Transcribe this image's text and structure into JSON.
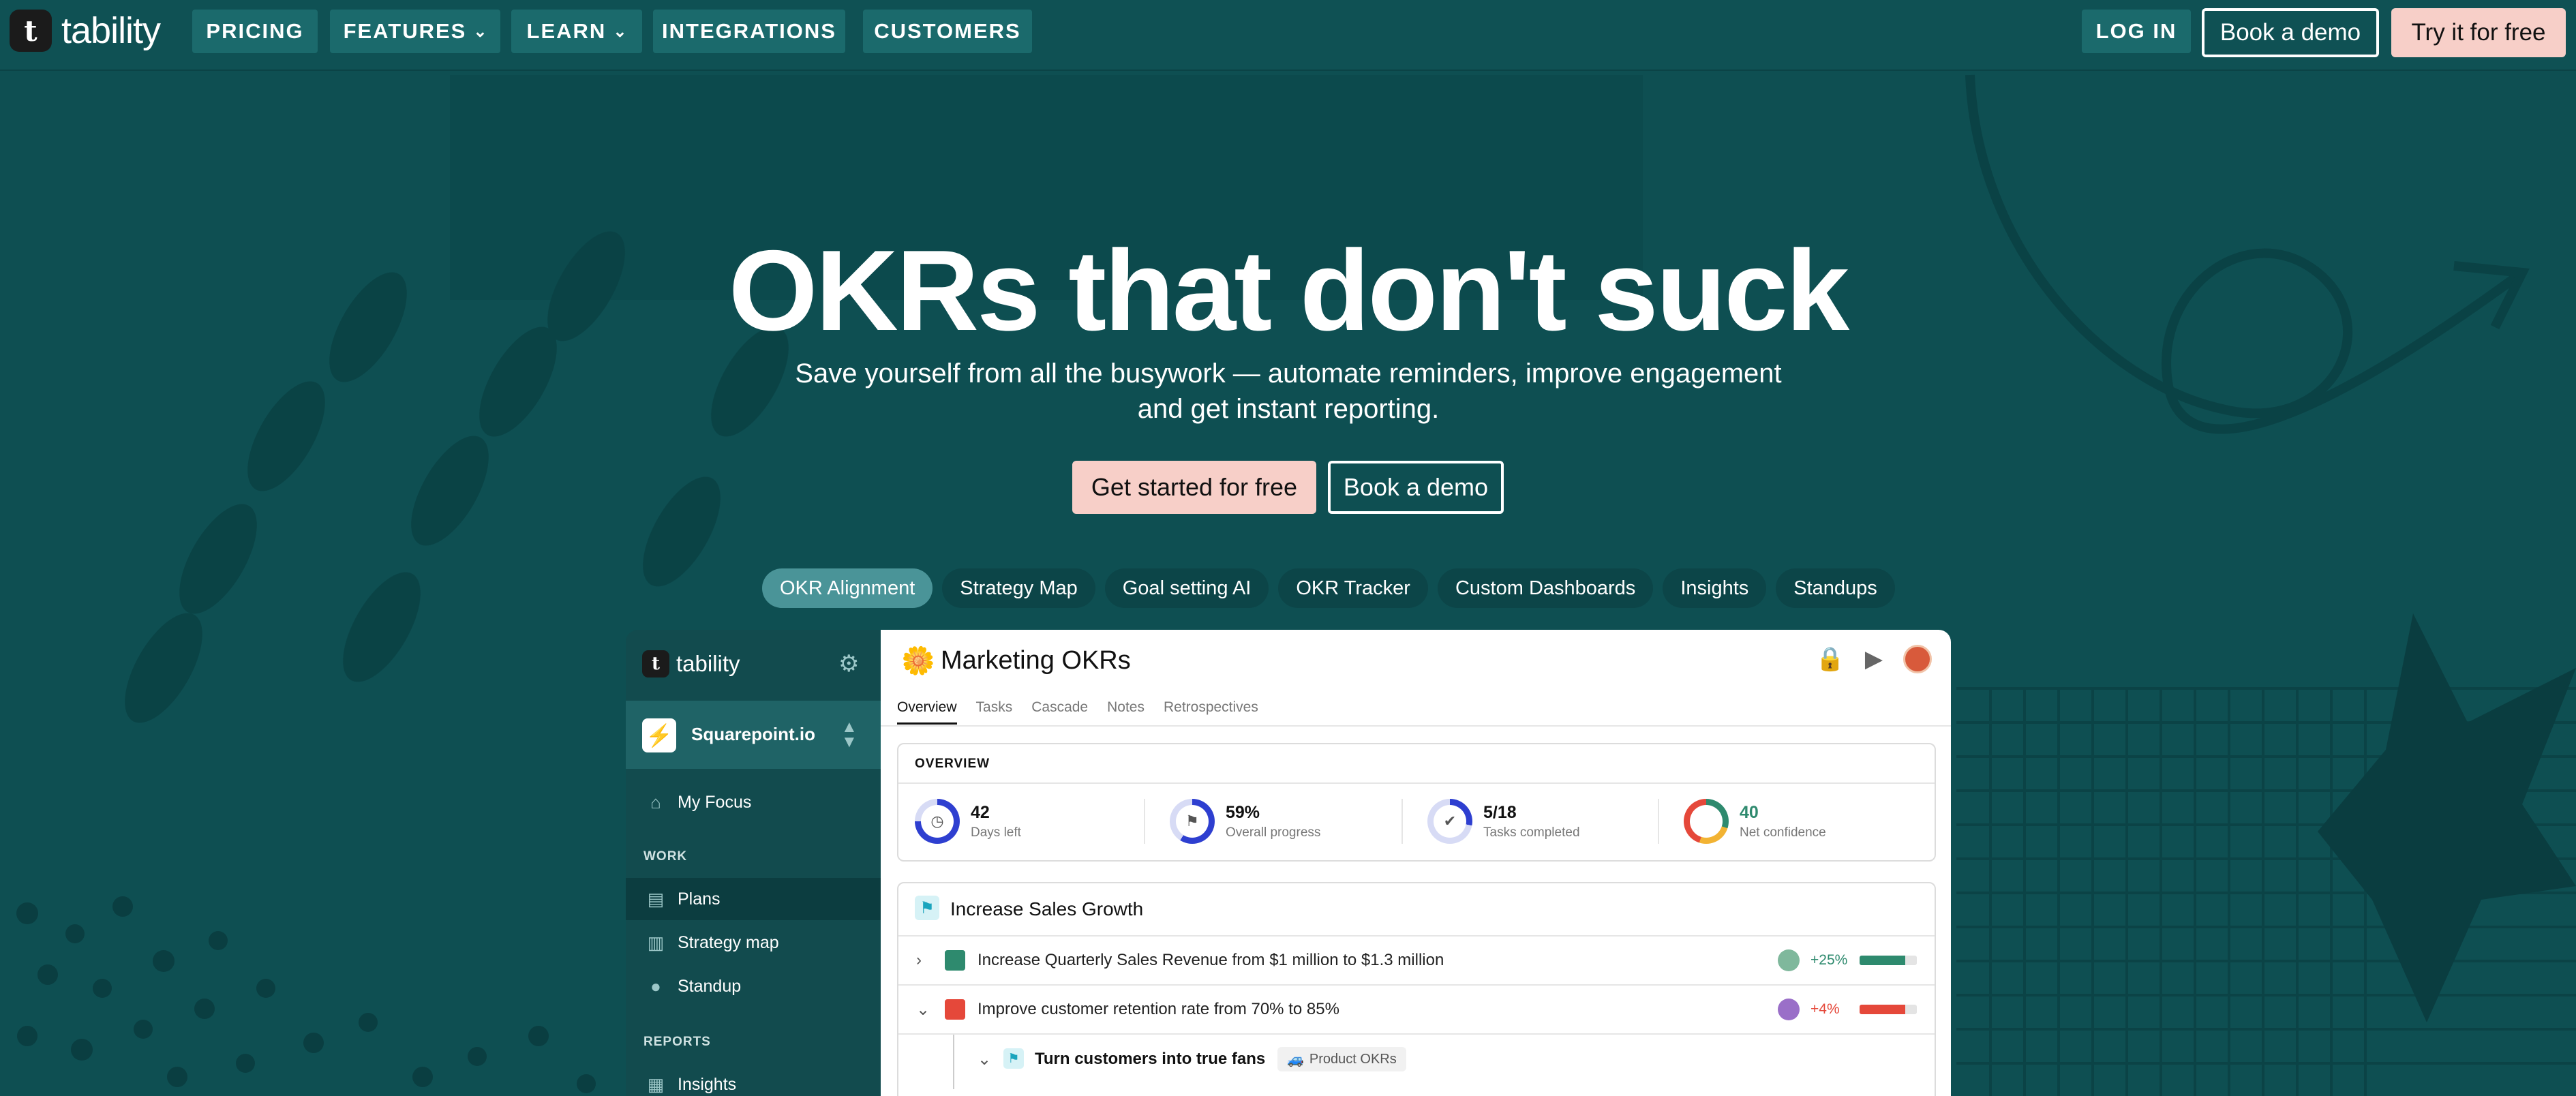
{
  "brand": {
    "name": "tability",
    "mark": "t"
  },
  "nav": {
    "pricing": "PRICING",
    "features": "FEATURES",
    "learn": "LEARN",
    "integrations": "INTEGRATIONS",
    "customers": "CUSTOMERS",
    "login": "LOG IN",
    "book_demo": "Book a demo",
    "try_free": "Try it for free"
  },
  "hero": {
    "title": "OKRs that don't suck",
    "subtitle": "Save yourself from all the busywork — automate reminders, improve engagement and get instant reporting.",
    "cta_primary": "Get started for free",
    "cta_secondary": "Book a demo"
  },
  "feature_tabs": [
    {
      "label": "OKR Alignment",
      "active": true
    },
    {
      "label": "Strategy Map"
    },
    {
      "label": "Goal setting AI"
    },
    {
      "label": "OKR Tracker"
    },
    {
      "label": "Custom Dashboards"
    },
    {
      "label": "Insights"
    },
    {
      "label": "Standups"
    }
  ],
  "app": {
    "sidebar": {
      "workspace": "Squarepoint.io",
      "my_focus": "My Focus",
      "work_header": "WORK",
      "plans": "Plans",
      "strategy_map": "Strategy map",
      "standup": "Standup",
      "reports_header": "REPORTS",
      "insights": "Insights"
    },
    "plan": {
      "title": "Marketing OKRs",
      "tabs": [
        "Overview",
        "Tasks",
        "Cascade",
        "Notes",
        "Retrospectives"
      ],
      "overview_header": "OVERVIEW",
      "stats": [
        {
          "value": "42",
          "label": "Days left"
        },
        {
          "value": "59%",
          "label": "Overall progress"
        },
        {
          "value": "5/18",
          "label": "Tasks completed"
        },
        {
          "value": "40",
          "label": "Net confidence"
        }
      ],
      "objective": "Increase Sales Growth",
      "key_results": [
        {
          "text": "Increase Quarterly Sales Revenue from $1 million to $1.3 million",
          "delta": "+25%",
          "progress": 0.8,
          "color": "#2e8a6e"
        },
        {
          "text": "Improve customer retention rate from 70% to 85%",
          "delta": "+4%",
          "progress": 0.8,
          "color": "#e5483a"
        }
      ],
      "sub_objective": "Turn customers into true fans",
      "sub_tag": "Product OKRs"
    }
  },
  "colors": {
    "background": "#0e4f52",
    "accent_pink": "#f7cfc8",
    "tab_active": "#4a9498"
  }
}
